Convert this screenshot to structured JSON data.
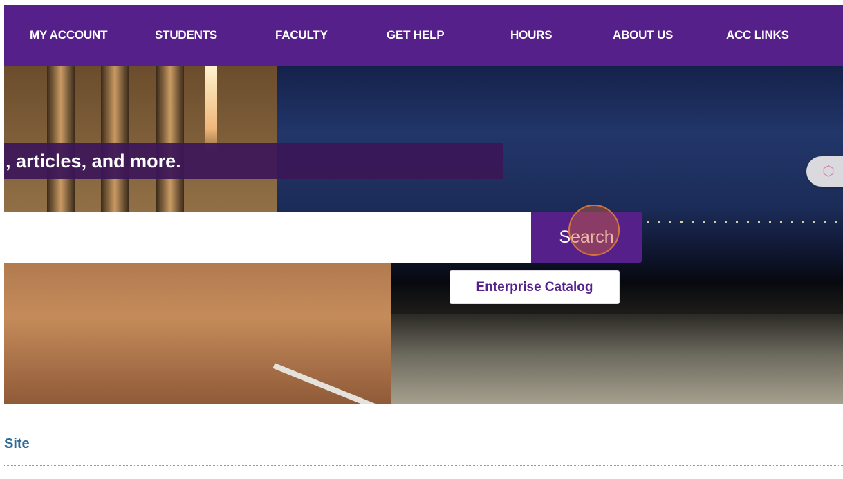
{
  "nav": {
    "items": [
      {
        "label": "MY ACCOUNT"
      },
      {
        "label": "STUDENTS"
      },
      {
        "label": "FACULTY"
      },
      {
        "label": "GET HELP"
      },
      {
        "label": "HOURS"
      },
      {
        "label": "ABOUT US"
      },
      {
        "label": "ACC LINKS"
      }
    ]
  },
  "hero": {
    "tagline": ", articles, and more."
  },
  "search": {
    "input_value": "",
    "button_label": "Search",
    "catalog_label": "Enterprise Catalog"
  },
  "section": {
    "heading": "Site"
  },
  "colors": {
    "brand_purple": "#55208a",
    "heading_blue": "#2c6b96"
  }
}
